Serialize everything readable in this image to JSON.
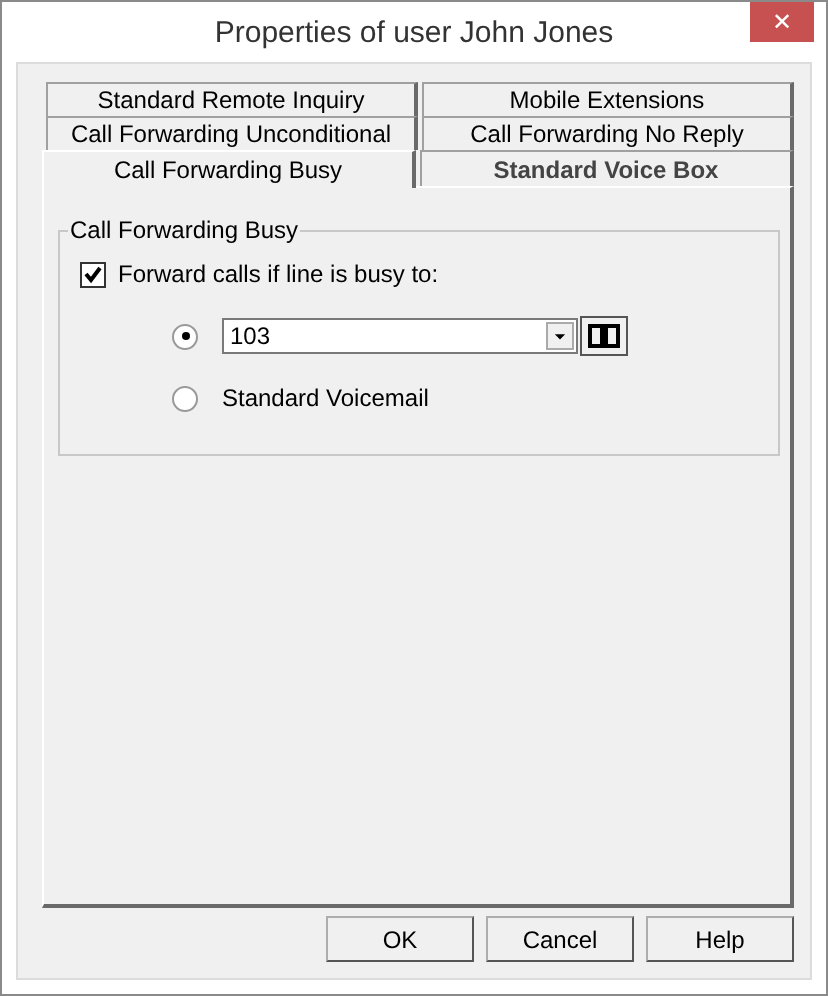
{
  "window": {
    "title": "Properties of user John Jones",
    "close": "✕"
  },
  "tab_rows": [
    [
      {
        "label": "Standard Remote Inquiry",
        "selected": false
      },
      {
        "label": "Mobile Extensions",
        "selected": false
      }
    ],
    [
      {
        "label": "Call Forwarding Unconditional",
        "selected": false
      },
      {
        "label": "Call Forwarding No Reply",
        "selected": false
      }
    ],
    [
      {
        "label": "Call Forwarding Busy",
        "selected": true
      },
      {
        "label": "Standard Voice Box",
        "selected": false
      }
    ]
  ],
  "group": {
    "title": "Call Forwarding Busy",
    "checkbox": {
      "label": "Forward calls if line is busy to:",
      "checked": true
    },
    "options": [
      {
        "kind": "combo",
        "value": "103",
        "selected": true
      },
      {
        "kind": "text",
        "label": "Standard Voicemail",
        "selected": false
      }
    ]
  },
  "buttons": [
    "OK",
    "Cancel",
    "Help"
  ]
}
